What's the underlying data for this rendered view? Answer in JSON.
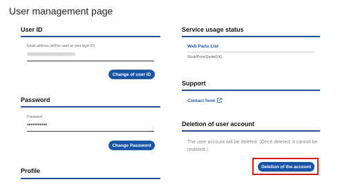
{
  "page": {
    "title": "User management page"
  },
  "user_id": {
    "title": "User ID",
    "email_label": "Email address (will be used as your login ID)",
    "change_button": "Change of user ID"
  },
  "password": {
    "title": "Password",
    "field_label": "Password",
    "value": "•••••••••••",
    "change_button": "Change Password"
  },
  "profile": {
    "title": "Profile"
  },
  "service_usage": {
    "title": "Service usage status",
    "link": "Web Parts List",
    "subtext": "Stock/Price/Quote(UK)"
  },
  "support": {
    "title": "Support",
    "contact_link": "Contact form"
  },
  "deletion": {
    "title": "Deletion of user account",
    "notice": "The user account will be deleted. (Once deleted, it cannot be restored.)",
    "button": "Deletion of the account"
  },
  "colors": {
    "accent": "#1a56a8",
    "rule": "#1f4f95",
    "highlight": "#d11a1a"
  },
  "icons": {
    "contact_link_icon": "external-link-icon"
  }
}
